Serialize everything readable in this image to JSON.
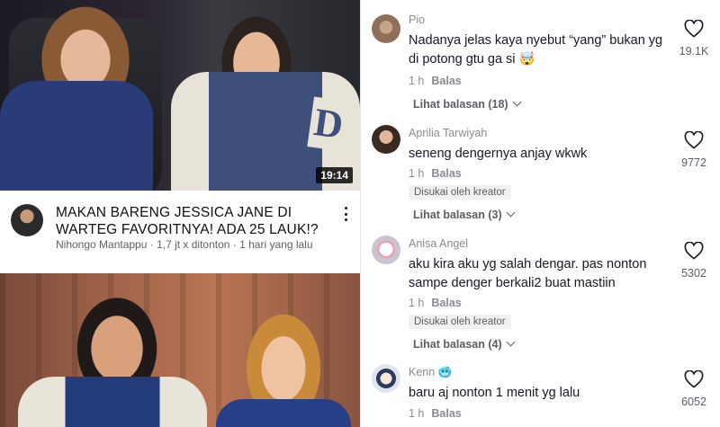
{
  "youtube": {
    "video1": {
      "duration": "19:14"
    },
    "title": "MAKAN BARENG JESSICA JANE DI WARTEG FAVORITNYA! ADA 25 LAUK!?",
    "meta": "Nihongo Mantappu · 1,7 jt x ditonton · 1 hari yang lalu",
    "jacket_letter": "D"
  },
  "comments": [
    {
      "name": "Pio",
      "text": "Nadanya jelas kaya nyebut “yang” bukan yg di potong gtu ga si 🤯",
      "time": "1 h",
      "reply": "Balas",
      "likes": "19.1K",
      "view_replies": "Lihat balasan (18)",
      "liked_by": ""
    },
    {
      "name": "Aprilia Tarwiyah",
      "text": "seneng dengernya anjay wkwk",
      "time": "1 h",
      "reply": "Balas",
      "likes": "9772",
      "view_replies": "Lihat balasan (3)",
      "liked_by": "Disukai oleh kreator"
    },
    {
      "name": "Anisa Angel",
      "text": "aku kira aku yg salah dengar. pas nonton sampe denger berkali2 buat mastiin",
      "time": "1 h",
      "reply": "Balas",
      "likes": "5302",
      "view_replies": "Lihat balasan (4)",
      "liked_by": "Disukai oleh kreator"
    },
    {
      "name": "Kenn 🥶",
      "text": "baru aj nonton 1 menit yg lalu",
      "time": "1 h",
      "reply": "Balas",
      "likes": "6052",
      "view_replies": "",
      "liked_by": ""
    }
  ],
  "colors": {
    "heart_outline": "#161823",
    "meta_gray": "#8a8b91"
  }
}
